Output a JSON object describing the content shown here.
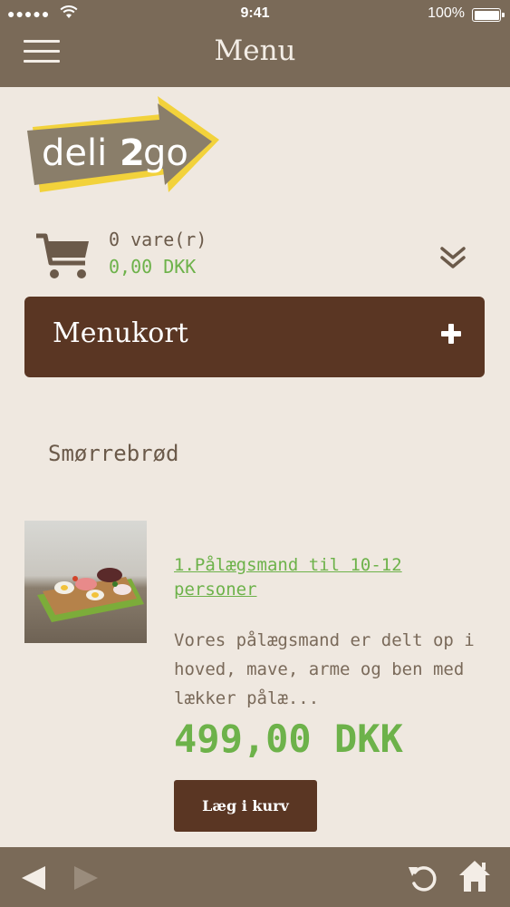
{
  "status_bar": {
    "signal": "●●●●●",
    "time": "9:41",
    "battery_pct": "100%"
  },
  "header": {
    "title": "Menu",
    "menu_icon": "hamburger-icon"
  },
  "logo": {
    "text_deli": "deli",
    "text_2": "2",
    "text_go": "go"
  },
  "cart": {
    "count_label": "0 vare(r)",
    "total": "0,00 DKK",
    "icon": "cart-icon",
    "expand_icon": "chevron-double-down-icon"
  },
  "menukort": {
    "label": "Menukort",
    "icon": "plus-icon"
  },
  "category": {
    "title": "Smørrebrød"
  },
  "products": [
    {
      "title": "1.Pålægsmand til 10-12 personer",
      "description": "Vores pålægsmand er delt op i hoved, mave, arme og ben med lækker pålæ...",
      "price": "499,00 DKK",
      "button_label": "Læg i kurv"
    }
  ],
  "bottom_bar": {
    "back_icon": "back-arrow-icon",
    "forward_icon": "forward-arrow-icon",
    "reload_icon": "reload-icon",
    "home_icon": "home-icon"
  },
  "colors": {
    "header_bg": "#7a6a58",
    "page_bg": "#efe8e0",
    "accent_brown": "#5a3623",
    "accent_green": "#6db24a",
    "logo_yellow": "#f2d23b"
  }
}
